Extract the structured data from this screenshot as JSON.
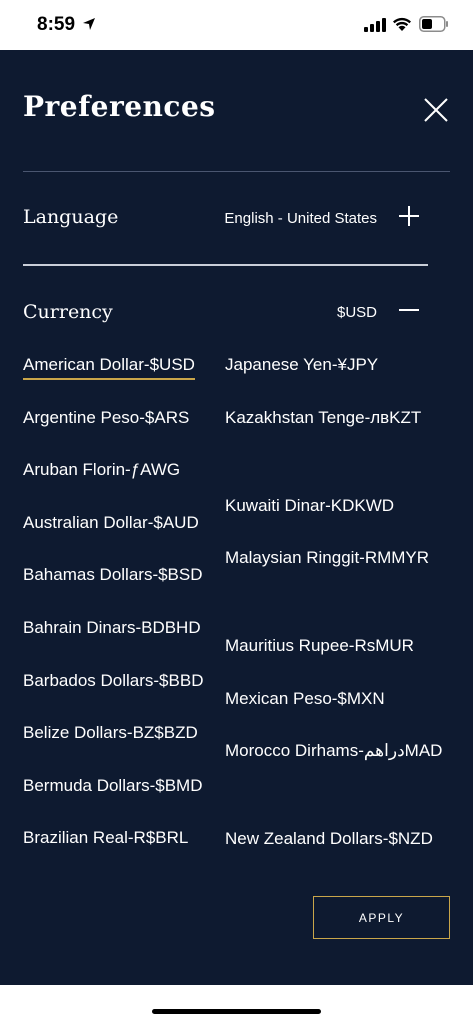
{
  "status_bar": {
    "time": "8:59",
    "icons": [
      "location-arrow-icon",
      "signal-icon",
      "wifi-icon",
      "battery-icon"
    ]
  },
  "panel": {
    "title": "Preferences",
    "close_icon": "close-icon",
    "language": {
      "label": "Language",
      "value": "English - United States",
      "toggle_icon": "plus-icon"
    },
    "currency": {
      "label": "Currency",
      "value": "$USD",
      "toggle_icon": "minus-icon",
      "left_column": [
        "American Dollar-$USD",
        "Argentine Peso-$ARS",
        "Aruban Florin-ƒAWG",
        "Australian Dollar-$AUD",
        "Bahamas Dollars-$BSD",
        "Bahrain Dinars-BDBHD",
        "Barbados Dollars-$BBD",
        "Belize Dollars-BZ$BZD",
        "Bermuda Dollars-$BMD",
        "Brazilian Real-R$BRL"
      ],
      "right_column": [
        "Japanese Yen-¥JPY",
        "Kazakhstan Tenge-лвKZT",
        "Kuwaiti Dinar-KDKWD",
        "Malaysian Ringgit-RMMYR",
        "Mauritius Rupee-RsMUR",
        "Mexican Peso-$MXN",
        "Morocco Dirhams-دراهمMAD",
        "New Zealand Dollars-$NZD"
      ],
      "selected": "American Dollar-$USD"
    },
    "apply_label": "APPLY"
  },
  "colors": {
    "panel_bg": "#0e1a30",
    "accent_gold": "#c9a64a",
    "text": "#ffffff"
  }
}
